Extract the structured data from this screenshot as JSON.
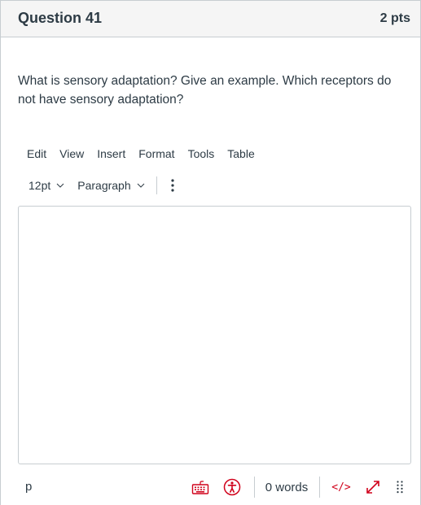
{
  "question": {
    "title": "Question 41",
    "points": "2 pts",
    "text": "What is sensory adaptation? Give an example. Which receptors do not have sensory adaptation?"
  },
  "editor": {
    "menu": [
      "Edit",
      "View",
      "Insert",
      "Format",
      "Tools",
      "Table"
    ],
    "font_size": "12pt",
    "block_format": "Paragraph",
    "content": "",
    "status": {
      "path": "p",
      "word_count": "0 words",
      "html_toggle": "</>"
    }
  },
  "colors": {
    "text": "#2d3b45",
    "accent_red": "#d0021b",
    "border": "#c7cdd1",
    "header_bg": "#f5f5f5"
  },
  "icons": [
    "chevron-down-icon",
    "more-vertical-icon",
    "keyboard-icon",
    "accessibility-icon",
    "fullscreen-icon",
    "resize-handle-icon"
  ]
}
